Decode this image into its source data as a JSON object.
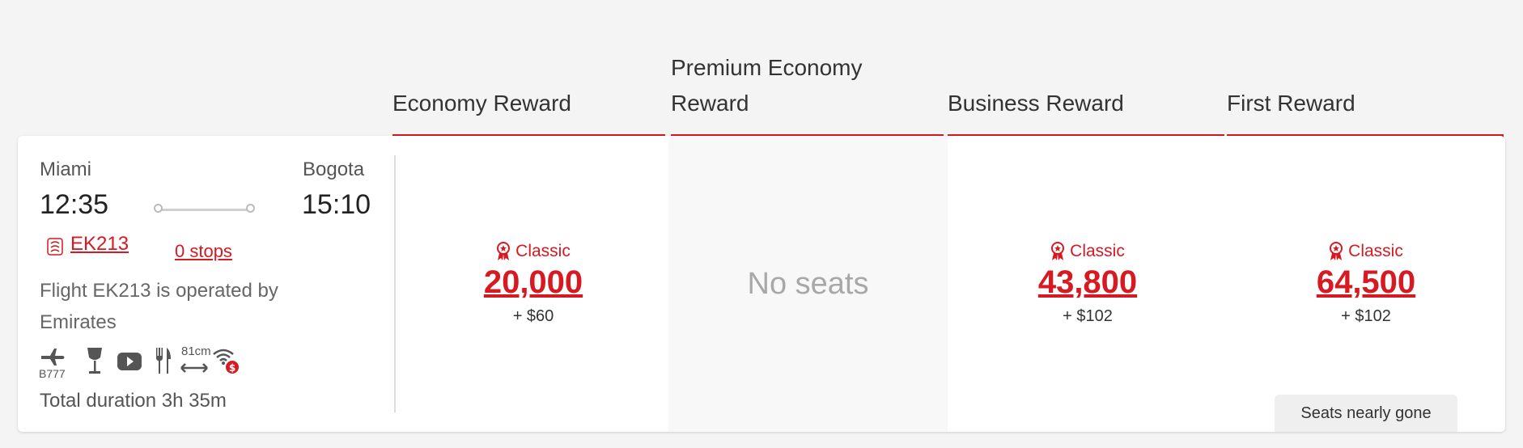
{
  "columns": {
    "economy": "Economy Reward",
    "premium_line1": "Premium Economy",
    "premium_line2": "Reward",
    "business": "Business Reward",
    "first": "First Reward"
  },
  "flight": {
    "origin": "Miami",
    "destination": "Bogota",
    "depart_time": "12:35",
    "arrive_time": "15:10",
    "flight_number": "EK213",
    "stops": "0 stops",
    "operated_by": "Flight EK213 is operated by Emirates",
    "aircraft": "B777",
    "seat_pitch": "81cm",
    "total_duration": "Total duration 3h 35m",
    "amenity_icons": [
      "plane-b777-icon",
      "wine-glass-icon",
      "video-play-icon",
      "cutlery-icon",
      "seat-pitch-icon",
      "wifi-paid-icon"
    ]
  },
  "fares": {
    "economy": {
      "badge": "Classic",
      "points": "20,000",
      "tax": "+ $60"
    },
    "premium": {
      "status": "No seats"
    },
    "business": {
      "badge": "Classic",
      "points": "43,800",
      "tax": "+ $102"
    },
    "first": {
      "badge": "Classic",
      "points": "64,500",
      "tax": "+ $102",
      "notice": "Seats nearly gone"
    }
  },
  "colors": {
    "accent": "#d71921",
    "background": "#f4f4f4"
  }
}
